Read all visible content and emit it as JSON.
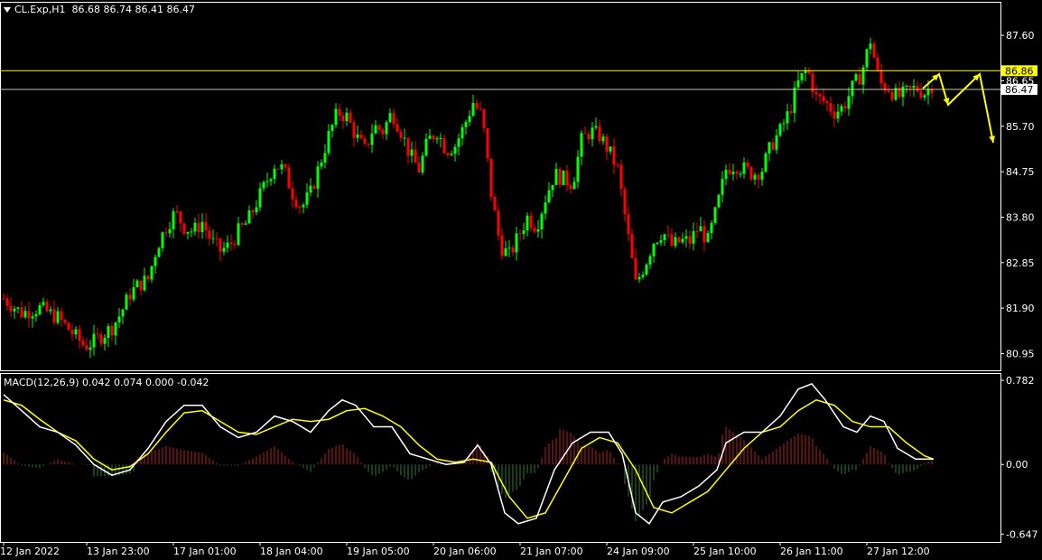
{
  "header": {
    "symbol": "CL.Exp,H1",
    "ohlc": "86.68 86.74 86.41 86.47"
  },
  "macd_header": {
    "label": "MACD(12,26,9) 0.042 0.074 0.000 -0.042"
  },
  "colors": {
    "background": "#000000",
    "bull": "#00FF00",
    "bear": "#FF0000",
    "grid_frame": "#FFFFFF",
    "level_line": "#FFFF00",
    "macd_line": "#FFFFFF",
    "signal_line": "#FFFF00",
    "hist_pos": "#B22222",
    "hist_neg": "#2E7D32"
  },
  "chart_data": [
    {
      "type": "candlestick",
      "ylim": [
        80.6,
        88.3
      ],
      "y_ticks": [
        "87.60",
        "86.65",
        "85.70",
        "84.75",
        "83.80",
        "82.85",
        "81.90",
        "80.95"
      ],
      "price_labels": [
        {
          "text": "86.86",
          "value": 86.86,
          "style": "yellow"
        },
        {
          "text": "86.47",
          "value": 86.47,
          "style": "white"
        }
      ],
      "levels": [
        86.86,
        86.47
      ],
      "x_ticks": [
        "12 Jan 2022",
        "13 Jan 23:00",
        "17 Jan 01:00",
        "18 Jan 04:00",
        "19 Jan 05:00",
        "20 Jan 06:00",
        "21 Jan 07:00",
        "24 Jan 09:00",
        "25 Jan 10:00",
        "26 Jan 11:00",
        "27 Jan 12:00"
      ],
      "close_path": [
        [
          0,
          82.1
        ],
        [
          10,
          81.95
        ],
        [
          20,
          81.8
        ],
        [
          30,
          81.85
        ],
        [
          40,
          81.9
        ],
        [
          50,
          81.8
        ],
        [
          60,
          81.7
        ],
        [
          70,
          81.5
        ],
        [
          80,
          81.3
        ],
        [
          90,
          81.1
        ],
        [
          100,
          81.2
        ],
        [
          110,
          81.35
        ],
        [
          120,
          81.5
        ],
        [
          130,
          81.8
        ],
        [
          140,
          82.2
        ],
        [
          150,
          82.4
        ],
        [
          160,
          82.5
        ],
        [
          170,
          83.2
        ],
        [
          180,
          83.6
        ],
        [
          190,
          83.9
        ],
        [
          200,
          83.6
        ],
        [
          210,
          83.5
        ],
        [
          220,
          83.7
        ],
        [
          230,
          83.3
        ],
        [
          240,
          83.1
        ],
        [
          250,
          83.2
        ],
        [
          260,
          83.5
        ],
        [
          270,
          83.7
        ],
        [
          280,
          84.1
        ],
        [
          290,
          84.5
        ],
        [
          300,
          84.9
        ],
        [
          310,
          84.8
        ],
        [
          320,
          84.3
        ],
        [
          330,
          84.0
        ],
        [
          340,
          84.3
        ],
        [
          350,
          84.9
        ],
        [
          360,
          85.5
        ],
        [
          370,
          86.0
        ],
        [
          380,
          85.9
        ],
        [
          390,
          85.5
        ],
        [
          400,
          85.2
        ],
        [
          410,
          85.7
        ],
        [
          420,
          85.6
        ],
        [
          430,
          86.0
        ],
        [
          440,
          85.6
        ],
        [
          450,
          85.1
        ],
        [
          460,
          84.8
        ],
        [
          470,
          85.4
        ],
        [
          480,
          85.6
        ],
        [
          490,
          85.2
        ],
        [
          500,
          85.3
        ],
        [
          510,
          85.7
        ],
        [
          520,
          86.2
        ],
        [
          530,
          85.9
        ],
        [
          540,
          84.3
        ],
        [
          550,
          83.2
        ],
        [
          560,
          83.0
        ],
        [
          570,
          83.4
        ],
        [
          580,
          83.8
        ],
        [
          590,
          83.6
        ],
        [
          600,
          84.2
        ],
        [
          610,
          84.7
        ],
        [
          620,
          84.6
        ],
        [
          630,
          84.5
        ],
        [
          640,
          85.4
        ],
        [
          650,
          85.6
        ],
        [
          660,
          85.5
        ],
        [
          670,
          85.2
        ],
        [
          680,
          84.8
        ],
        [
          690,
          83.6
        ],
        [
          700,
          82.4
        ],
        [
          710,
          82.8
        ],
        [
          720,
          83.3
        ],
        [
          730,
          83.5
        ],
        [
          740,
          83.2
        ],
        [
          750,
          83.3
        ],
        [
          760,
          83.3
        ],
        [
          770,
          83.6
        ],
        [
          780,
          83.3
        ],
        [
          790,
          84.0
        ],
        [
          800,
          84.8
        ],
        [
          810,
          84.9
        ],
        [
          820,
          84.8
        ],
        [
          830,
          84.7
        ],
        [
          840,
          84.8
        ],
        [
          850,
          85.3
        ],
        [
          860,
          85.6
        ],
        [
          870,
          86.0
        ],
        [
          880,
          86.6
        ],
        [
          890,
          86.9
        ],
        [
          900,
          86.3
        ],
        [
          910,
          86.2
        ],
        [
          920,
          86.0
        ],
        [
          930,
          86.1
        ],
        [
          940,
          86.5
        ],
        [
          950,
          86.8
        ],
        [
          960,
          87.5
        ],
        [
          970,
          86.6
        ],
        [
          980,
          86.5
        ],
        [
          990,
          86.3
        ],
        [
          1000,
          86.4
        ],
        [
          1010,
          86.5
        ],
        [
          1020,
          86.4
        ],
        [
          1030,
          86.6
        ]
      ],
      "annotations": [
        "yellow zig-zag arrows forecast beyond last candle"
      ]
    },
    {
      "type": "macd",
      "name": "MACD(12,26,9)",
      "ylim": [
        -0.72,
        0.85
      ],
      "y_ticks": [
        "0.782",
        "0.00",
        "-0.647"
      ],
      "macd": [
        [
          0,
          0.65
        ],
        [
          20,
          0.5
        ],
        [
          40,
          0.35
        ],
        [
          60,
          0.3
        ],
        [
          80,
          0.18
        ],
        [
          100,
          0.0
        ],
        [
          120,
          -0.1
        ],
        [
          140,
          -0.05
        ],
        [
          160,
          0.15
        ],
        [
          180,
          0.4
        ],
        [
          200,
          0.55
        ],
        [
          220,
          0.55
        ],
        [
          240,
          0.35
        ],
        [
          260,
          0.25
        ],
        [
          280,
          0.3
        ],
        [
          300,
          0.45
        ],
        [
          320,
          0.4
        ],
        [
          340,
          0.3
        ],
        [
          360,
          0.5
        ],
        [
          375,
          0.6
        ],
        [
          390,
          0.55
        ],
        [
          410,
          0.35
        ],
        [
          430,
          0.35
        ],
        [
          450,
          0.1
        ],
        [
          470,
          0.05
        ],
        [
          490,
          0.0
        ],
        [
          510,
          0.02
        ],
        [
          525,
          0.18
        ],
        [
          540,
          0.0
        ],
        [
          555,
          -0.45
        ],
        [
          570,
          -0.55
        ],
        [
          590,
          -0.5
        ],
        [
          610,
          -0.05
        ],
        [
          630,
          0.2
        ],
        [
          650,
          0.3
        ],
        [
          670,
          0.3
        ],
        [
          685,
          0.1
        ],
        [
          700,
          -0.45
        ],
        [
          715,
          -0.55
        ],
        [
          730,
          -0.35
        ],
        [
          750,
          -0.3
        ],
        [
          770,
          -0.2
        ],
        [
          790,
          -0.05
        ],
        [
          800,
          0.2
        ],
        [
          820,
          0.3
        ],
        [
          840,
          0.3
        ],
        [
          860,
          0.45
        ],
        [
          880,
          0.7
        ],
        [
          895,
          0.75
        ],
        [
          910,
          0.6
        ],
        [
          930,
          0.35
        ],
        [
          945,
          0.3
        ],
        [
          960,
          0.45
        ],
        [
          975,
          0.4
        ],
        [
          990,
          0.15
        ],
        [
          1010,
          0.05
        ],
        [
          1030,
          0.05
        ]
      ],
      "signal": [
        [
          0,
          0.6
        ],
        [
          20,
          0.55
        ],
        [
          40,
          0.42
        ],
        [
          60,
          0.3
        ],
        [
          80,
          0.22
        ],
        [
          100,
          0.05
        ],
        [
          120,
          -0.05
        ],
        [
          140,
          -0.02
        ],
        [
          160,
          0.1
        ],
        [
          180,
          0.3
        ],
        [
          200,
          0.48
        ],
        [
          220,
          0.5
        ],
        [
          240,
          0.4
        ],
        [
          260,
          0.3
        ],
        [
          280,
          0.28
        ],
        [
          300,
          0.35
        ],
        [
          320,
          0.42
        ],
        [
          340,
          0.4
        ],
        [
          360,
          0.42
        ],
        [
          380,
          0.5
        ],
        [
          400,
          0.52
        ],
        [
          420,
          0.45
        ],
        [
          440,
          0.35
        ],
        [
          460,
          0.18
        ],
        [
          480,
          0.05
        ],
        [
          500,
          0.02
        ],
        [
          520,
          0.05
        ],
        [
          540,
          0.02
        ],
        [
          560,
          -0.3
        ],
        [
          580,
          -0.5
        ],
        [
          600,
          -0.45
        ],
        [
          620,
          -0.15
        ],
        [
          640,
          0.15
        ],
        [
          660,
          0.25
        ],
        [
          680,
          0.2
        ],
        [
          700,
          -0.05
        ],
        [
          720,
          -0.4
        ],
        [
          740,
          -0.45
        ],
        [
          760,
          -0.35
        ],
        [
          780,
          -0.25
        ],
        [
          800,
          -0.05
        ],
        [
          820,
          0.15
        ],
        [
          840,
          0.3
        ],
        [
          860,
          0.35
        ],
        [
          880,
          0.5
        ],
        [
          900,
          0.6
        ],
        [
          920,
          0.55
        ],
        [
          940,
          0.4
        ],
        [
          960,
          0.35
        ],
        [
          980,
          0.35
        ],
        [
          1000,
          0.2
        ],
        [
          1020,
          0.08
        ],
        [
          1030,
          0.05
        ]
      ]
    }
  ]
}
